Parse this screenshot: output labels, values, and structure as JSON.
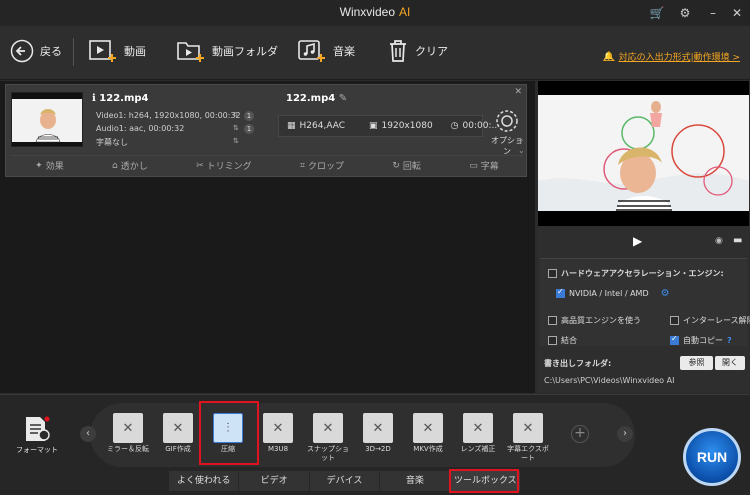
{
  "app": {
    "title": "Winxvideo",
    "title_ai": "AI"
  },
  "toolbar": {
    "back": "戻る",
    "video": "動画",
    "video_folder": "動画フォルダ",
    "music": "音楽",
    "clear": "クリア",
    "format_link": "対応の入出力形式|動作環境 >"
  },
  "file": {
    "source_name": "122.mp4",
    "video_line": "Video1: h264, 1920x1080, 00:00:32",
    "audio_line": "Audio1: aac, 00:00:32",
    "subtitle_line": "字幕なし",
    "badge": "1",
    "output_name": "122.mp4",
    "codec": "H264,AAC",
    "resolution": "1920x1080",
    "duration": "00:00:..",
    "option": "オプション"
  },
  "edit_tools": [
    "効果",
    "透かし",
    "トリミング",
    "クロップ",
    "回転",
    "字幕"
  ],
  "right": {
    "hw_title": "ハードウェアアクセラレーション・エンジン:",
    "hw_vendor": "NVIDIA / Intel / AMD",
    "hq_engine": "高品質エンジンを使う",
    "deinterlace": "インターレース解除",
    "merge": "結合",
    "auto_copy": "自動コピー",
    "help": "?",
    "output_folder_label": "書き出しフォルダ:",
    "browse": "参照",
    "open": "開く",
    "output_path": "C:\\Users\\PC\\Videos\\Winxvideo AI"
  },
  "bottom": {
    "format_label": "フォーマット",
    "tools": [
      {
        "label": "ミラー＆反転"
      },
      {
        "label": "GIF作成"
      },
      {
        "label": "圧縮"
      },
      {
        "label": "M3U8"
      },
      {
        "label": "スナップショット"
      },
      {
        "label": "3D→2D"
      },
      {
        "label": "MKV作成"
      },
      {
        "label": "レンズ補正"
      },
      {
        "label": "字幕エクスポート"
      }
    ],
    "categories": [
      "よく使われる",
      "ビデオ",
      "デバイス",
      "音楽",
      "ツールボックス"
    ],
    "run": "RUN"
  },
  "colors": {
    "accent": "#f5a623",
    "highlight": "#e1131e",
    "run_blue": "#1e6fd0"
  }
}
